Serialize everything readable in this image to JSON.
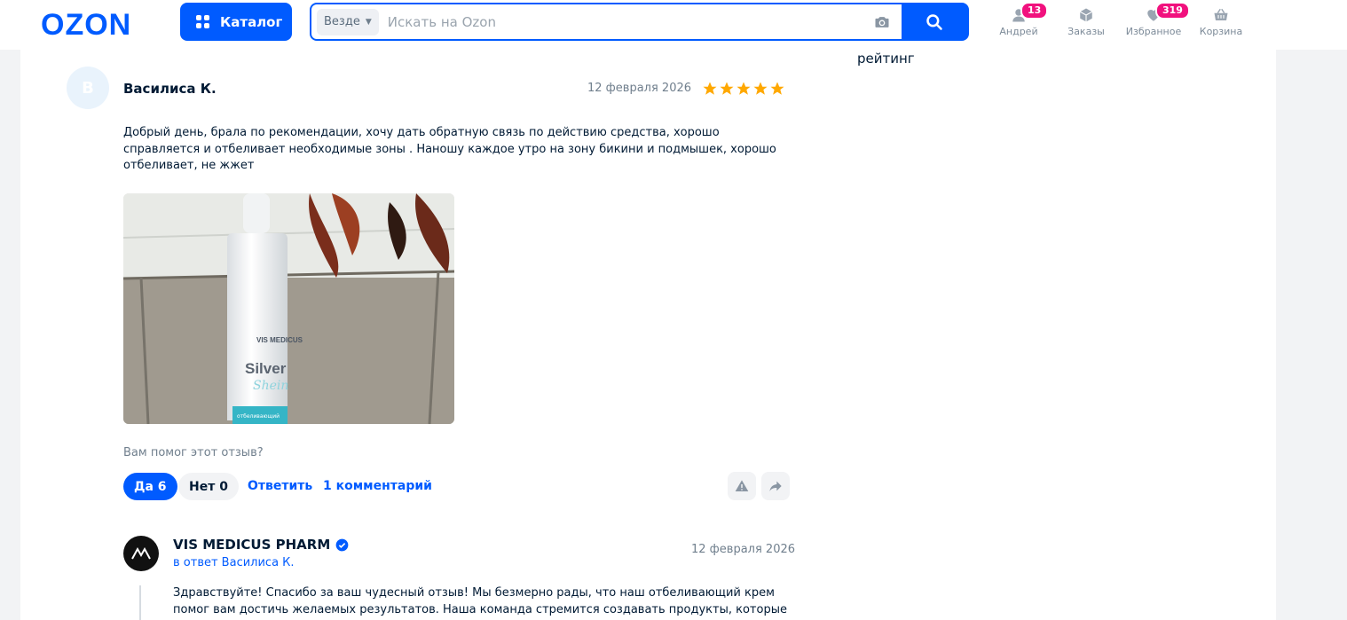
{
  "header": {
    "logo": "OZON",
    "catalog_label": "Каталог",
    "search": {
      "scope": "Везде",
      "placeholder": "Искать на Ozon"
    },
    "nav": [
      {
        "label": "Андрей",
        "badge": "13",
        "icon": "user-icon"
      },
      {
        "label": "Заказы",
        "badge": "",
        "icon": "box-icon"
      },
      {
        "label": "Избранное",
        "badge": "319",
        "icon": "heart-icon"
      },
      {
        "label": "Корзина",
        "badge": "",
        "icon": "basket-icon"
      }
    ]
  },
  "sidebar": {
    "rating_label": "рейтинг"
  },
  "review": {
    "avatar_letter": "В",
    "author": "Василиса К.",
    "date": "12 февраля 2026",
    "rating": 5,
    "text": "Добрый день, брала по рекомендации, хочу дать обратную связь по действию средства, хорошо справляется и отбеливает необходимые зоны . Наношу каждое утро на зону бикини и подмышек, хорошо отбеливает, не жжет",
    "photo": {
      "product_brand": "VIS MEDICUS",
      "product_name_1": "Silver",
      "product_name_2": "Shein",
      "product_sub": "отбеливающий"
    },
    "helpful_question": "Вам помог этот отзыв?",
    "yes_label": "Да 6",
    "no_label": "Нет 0",
    "reply_label": "Ответить",
    "comments_label": "1 комментарий"
  },
  "seller_reply": {
    "name": "VIS MEDICUS PHARM",
    "in_reply_to": "в ответ Василиса К.",
    "date": "12 февраля 2026",
    "text": "Здравствуйте! Спасибо за ваш чудесный отзыв! Мы безмерно рады, что наш отбеливающий крем помог вам достичь желаемых результатов. Наша команда стремится создавать продукты, которые не"
  },
  "colors": {
    "brand": "#005bff",
    "badge": "#f1117e",
    "star": "#ffa800"
  }
}
